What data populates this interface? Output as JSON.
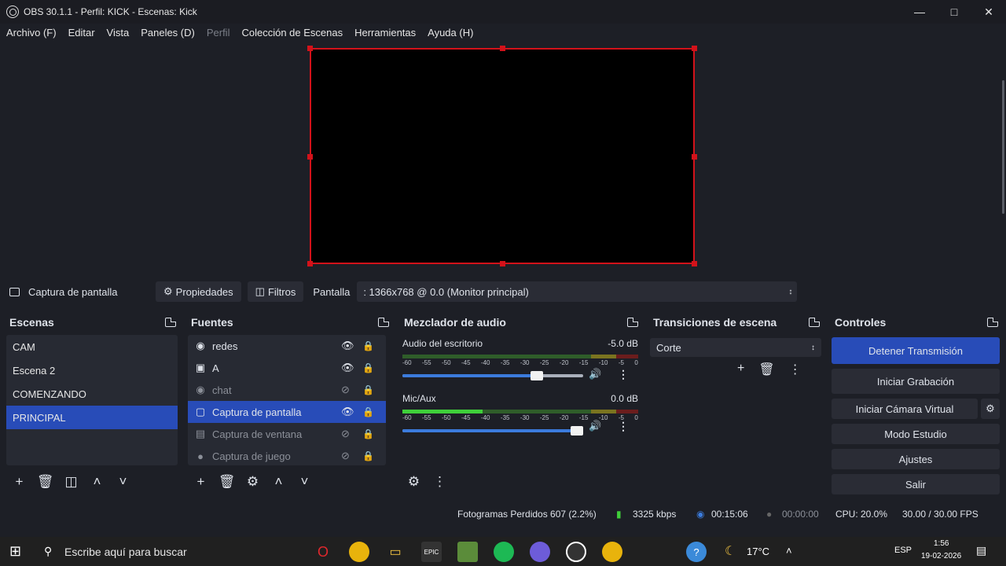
{
  "window": {
    "title": "OBS 30.1.1 - Perfil: KICK - Escenas: Kick"
  },
  "menu": [
    "Archivo (F)",
    "Editar",
    "Vista",
    "Paneles (D)",
    "Perfil",
    "Colección de Escenas",
    "Herramientas",
    "Ayuda (H)"
  ],
  "source_bar": {
    "source_name": "Captura de pantalla",
    "properties_label": "Propiedades",
    "filters_label": "Filtros",
    "screen_label": "Pantalla",
    "screen_value": ": 1366x768 @ 0.0 (Monitor principal)"
  },
  "scenes": {
    "title": "Escenas",
    "items": [
      "CAM",
      "Escena 2",
      "COMENZANDO",
      "PRINCIPAL"
    ],
    "active_index": 3
  },
  "sources": {
    "title": "Fuentes",
    "items": [
      {
        "name": "redes",
        "icon": "browser-icon",
        "visible": true
      },
      {
        "name": "A",
        "icon": "camera-icon",
        "visible": true
      },
      {
        "name": "chat",
        "icon": "browser-icon",
        "visible": false
      },
      {
        "name": "Captura de pantalla",
        "icon": "monitor-icon",
        "visible": true,
        "active": true
      },
      {
        "name": "Captura de ventana",
        "icon": "window-icon",
        "visible": false
      },
      {
        "name": "Captura de juego",
        "icon": "gamepad-icon",
        "visible": false
      }
    ]
  },
  "mixer": {
    "title": "Mezclador de audio",
    "ticks": [
      "-60",
      "-55",
      "-50",
      "-45",
      "-40",
      "-35",
      "-30",
      "-25",
      "-20",
      "-15",
      "-10",
      "-5",
      "0"
    ],
    "channels": [
      {
        "name": "Audio del escritorio",
        "db": "-5.0 dB",
        "level": 0.0,
        "volume": 0.78
      },
      {
        "name": "Mic/Aux",
        "db": "0.0 dB",
        "level": 0.34,
        "volume": 1.0
      }
    ]
  },
  "transitions": {
    "title": "Transiciones de escena",
    "selected": "Corte"
  },
  "controls": {
    "title": "Controles",
    "stop_stream": "Detener Transmisión",
    "start_record": "Iniciar Grabación",
    "virtual_cam": "Iniciar Cámara Virtual",
    "studio_mode": "Modo Estudio",
    "settings": "Ajustes",
    "exit": "Salir"
  },
  "status": {
    "dropped_frames": "Fotogramas Perdidos 607 (2.2%)",
    "bitrate": "3325 kbps",
    "stream_time": "00:15:06",
    "record_time": "00:00:00",
    "cpu": "CPU: 20.0%",
    "fps": "30.00 / 30.00 FPS"
  },
  "taskbar": {
    "search_placeholder": "Escribe aquí para buscar",
    "weather": "17°C",
    "lang": "ESP",
    "time": "1:56",
    "date": "19-02-2026"
  },
  "colors": {
    "accent": "#284cb8",
    "selection_border": "#d3121a",
    "background": "#1d1f26"
  }
}
